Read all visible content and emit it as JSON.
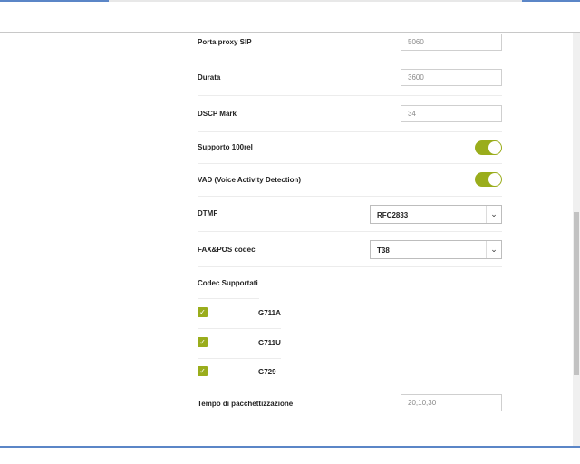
{
  "fields": {
    "porta_proxy": {
      "label": "Porta proxy SIP",
      "value": "5060"
    },
    "durata": {
      "label": "Durata",
      "value": "3600"
    },
    "dscp": {
      "label": "DSCP Mark",
      "value": "34"
    },
    "tempo": {
      "label": "Tempo di pacchettizzazione",
      "value": "20,10,30"
    }
  },
  "toggles": {
    "supporto_100rel": {
      "label": "Supporto 100rel",
      "on": true
    },
    "vad": {
      "label": "VAD (Voice Activity Detection)",
      "on": true
    }
  },
  "selects": {
    "dtmf": {
      "label": "DTMF",
      "value": "RFC2833"
    },
    "faxpos": {
      "label": "FAX&POS codec",
      "value": "T38"
    }
  },
  "codecs": {
    "title": "Codec Supportati",
    "items": [
      {
        "name": "G711A",
        "checked": true
      },
      {
        "name": "G711U",
        "checked": true
      },
      {
        "name": "G729",
        "checked": true
      }
    ]
  },
  "colors": {
    "accent": "#9aad1c",
    "border": "#cfcfcf"
  },
  "icons": {
    "caret": "chevron-down-icon",
    "check": "checkmark-icon"
  }
}
